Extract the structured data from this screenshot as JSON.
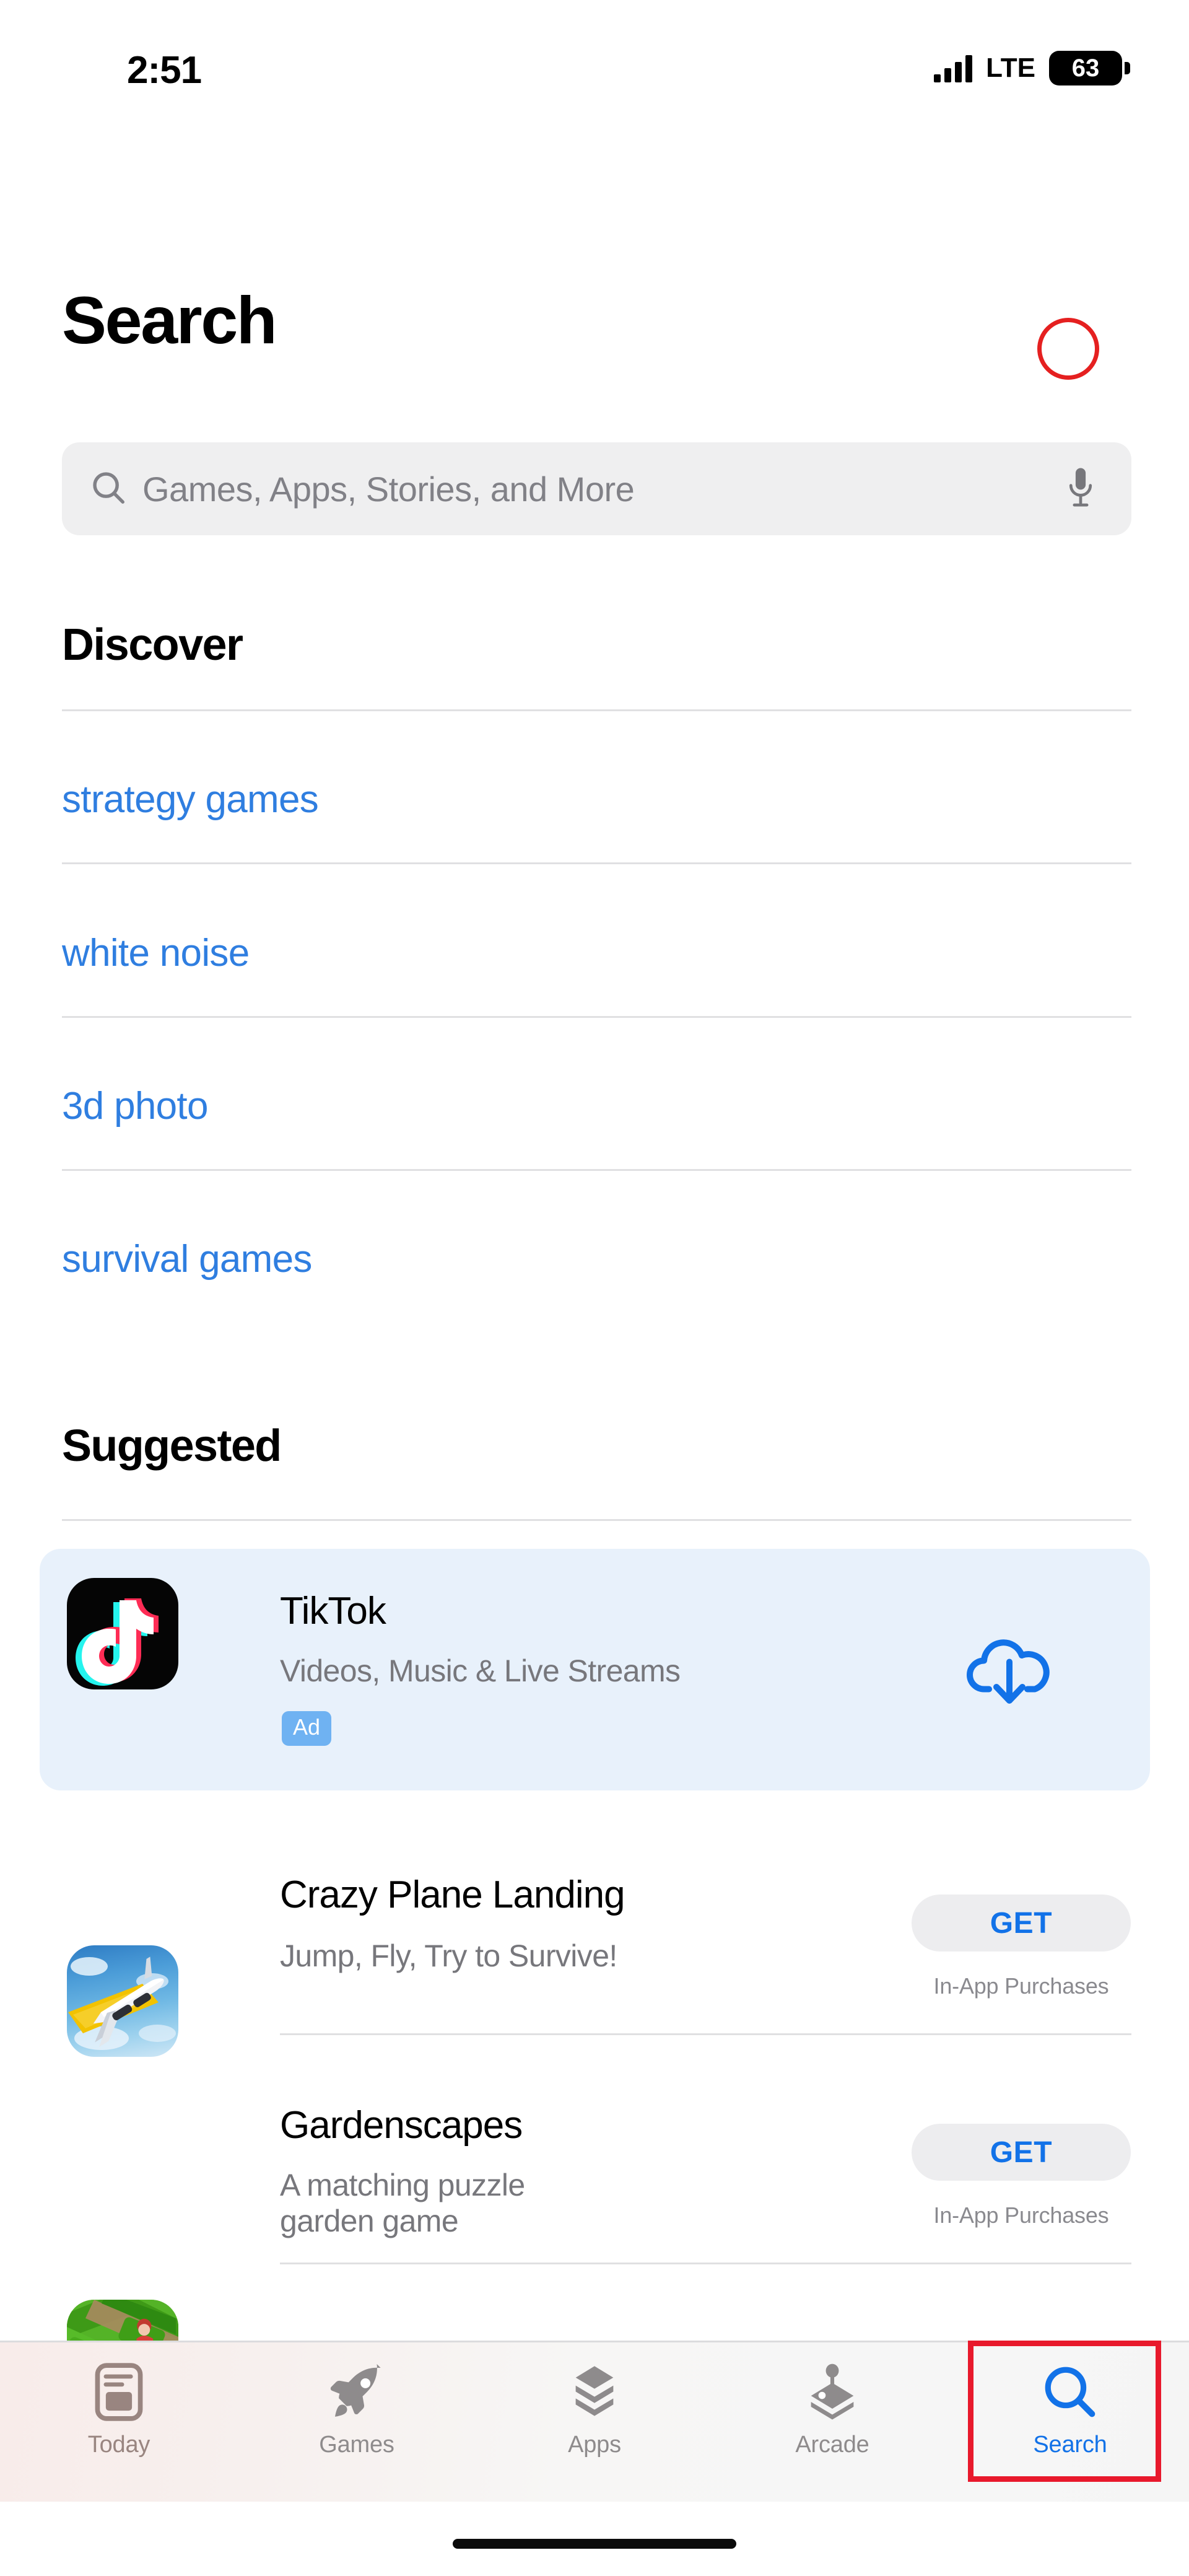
{
  "status_bar": {
    "time": "2:51",
    "network_type": "LTE",
    "battery_percent": "63",
    "signal_icon": "cellular-signal-icon",
    "battery_icon": "battery-icon"
  },
  "header": {
    "title": "Search",
    "avatar_icon": "account-avatar-icon"
  },
  "search": {
    "placeholder": "Games, Apps, Stories, and More",
    "value": "",
    "search_icon": "search-icon",
    "mic_icon": "microphone-icon"
  },
  "discover": {
    "title": "Discover",
    "items": [
      {
        "label": "strategy games"
      },
      {
        "label": "white noise"
      },
      {
        "label": "3d photo"
      },
      {
        "label": "survival games"
      }
    ]
  },
  "suggested": {
    "title": "Suggested",
    "apps": [
      {
        "name": "TikTok",
        "subtitle": "Videos, Music & Live Streams",
        "badge": "Ad",
        "action_icon": "cloud-download-icon",
        "action_label": "",
        "iap_note": "",
        "is_ad": true,
        "icon_name": "tiktok-app-icon"
      },
      {
        "name": "Crazy Plane Landing",
        "subtitle": "Jump, Fly, Try to Survive!",
        "badge": "",
        "action_icon": "",
        "action_label": "GET",
        "iap_note": "In-App Purchases",
        "is_ad": false,
        "icon_name": "crazy-plane-landing-app-icon"
      },
      {
        "name": "Gardenscapes",
        "subtitle": "A matching puzzle\ngarden game",
        "subtitle_line1": "A matching puzzle",
        "subtitle_line2": "garden game",
        "badge": "",
        "action_icon": "",
        "action_label": "GET",
        "iap_note": "In-App Purchases",
        "is_ad": false,
        "icon_name": "gardenscapes-app-icon"
      }
    ]
  },
  "tab_bar": {
    "tabs": [
      {
        "label": "Today",
        "icon": "today-newspaper-icon",
        "active": false
      },
      {
        "label": "Games",
        "icon": "rocket-icon",
        "active": false
      },
      {
        "label": "Apps",
        "icon": "stacked-layers-icon",
        "active": false
      },
      {
        "label": "Arcade",
        "icon": "joystick-icon",
        "active": false
      },
      {
        "label": "Search",
        "icon": "search-icon",
        "active": true
      }
    ]
  },
  "annotations": {
    "circle_target": "account-avatar-button",
    "rect_target": "tab-search",
    "color": "#E52020"
  },
  "colors": {
    "accent_blue": "#1272E8",
    "link_blue": "#2F7EE0",
    "ad_badge_blue": "#6FB2F2",
    "ad_card_bg": "#E8F1FB",
    "field_gray": "#EFEFF0",
    "subtext_gray": "#77777C",
    "divider": "#E0E0E2",
    "annotation_red": "#E52020"
  }
}
